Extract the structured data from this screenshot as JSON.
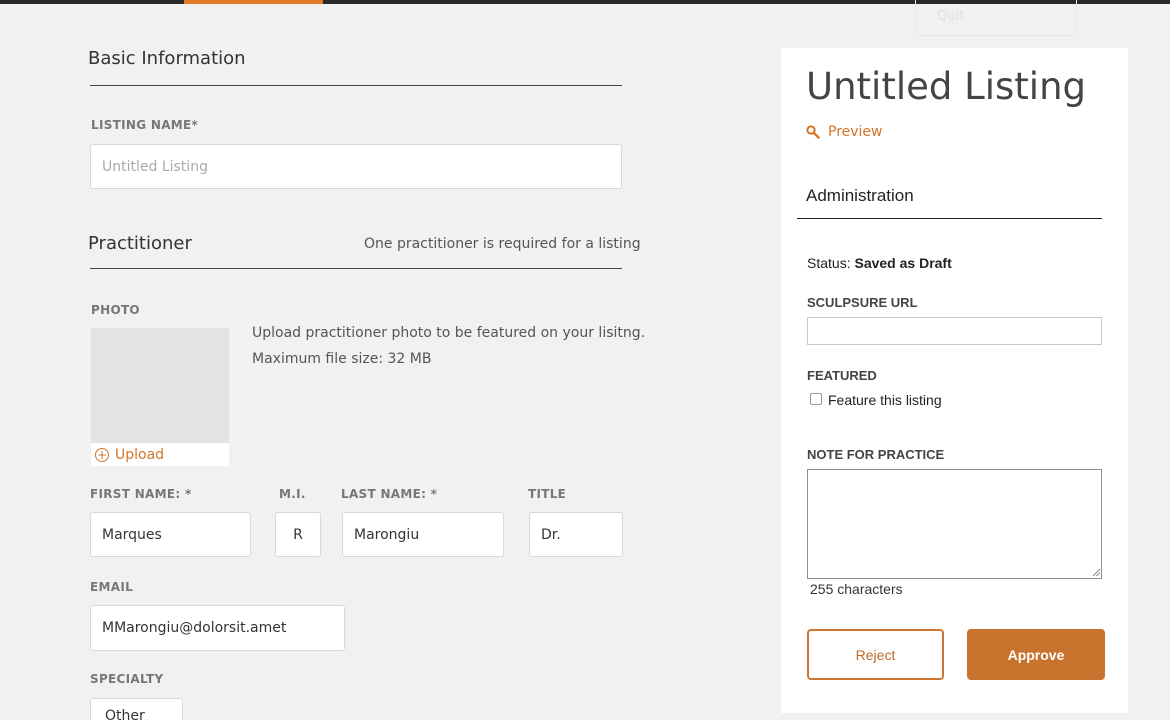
{
  "ghost_menu": {
    "item": "Quit"
  },
  "basic_info": {
    "heading": "Basic Information",
    "listing_name_label": "LISTING NAME*",
    "listing_name_value": "",
    "listing_name_placeholder": "Untitled Listing"
  },
  "practitioner": {
    "heading": "Practitioner",
    "note": "One practitioner is required for a listing",
    "photo_label": "PHOTO",
    "photo_help_line1": "Upload practitioner photo to be featured on your lisitng.",
    "photo_help_line2": "Maximum file size: 32 MB",
    "upload_label": "Upload",
    "first_name_label": "FIRST NAME: *",
    "first_name_value": "Marques",
    "mi_label": "M.I.",
    "mi_value": "R",
    "last_name_label": "LAST NAME: *",
    "last_name_value": "Marongiu",
    "title_label": "TITLE",
    "title_value": "Dr.",
    "email_label": "EMAIL",
    "email_value": "MMarongiu@dolorsit.amet",
    "specialty_label": "SPECIALTY",
    "specialty_value": "Other"
  },
  "sidebar": {
    "listing_title": "Untitled Listing",
    "preview_label": "Preview",
    "admin_heading": "Administration",
    "status_label": "Status:",
    "status_value": "Saved as Draft",
    "url_label": "SCULPSURE URL",
    "url_value": "",
    "featured_label": "FEATURED",
    "featured_checkbox_label": "Feature this listing",
    "featured_checked": false,
    "note_label": "NOTE FOR PRACTICE",
    "note_value": "",
    "char_count": "255 characters",
    "reject_label": "Reject",
    "approve_label": "Approve"
  },
  "colors": {
    "accent": "#d47525",
    "approve_bg": "#c8732d",
    "page_bg": "#f1f1f1"
  }
}
